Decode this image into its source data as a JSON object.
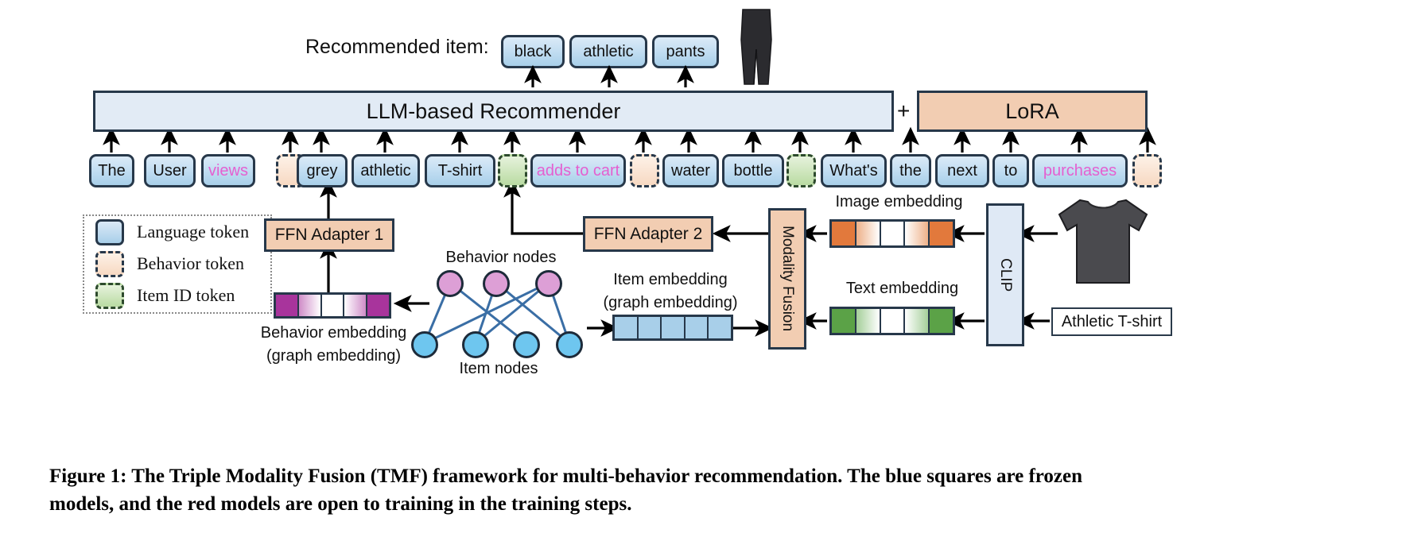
{
  "figure": {
    "recommended_label": "Recommended item:",
    "recommended_tokens": [
      "black",
      "athletic",
      "pants"
    ],
    "recommender_bar": "LLM-based Recommender",
    "plus": "+",
    "lora": "LoRA"
  },
  "tokens": [
    {
      "text": "The",
      "type": "lang"
    },
    {
      "text": "User",
      "type": "lang"
    },
    {
      "text": "views",
      "type": "lang",
      "pink": true
    },
    {
      "text": "",
      "type": "behav"
    },
    {
      "text": "grey",
      "type": "lang"
    },
    {
      "text": "athletic",
      "type": "lang"
    },
    {
      "text": "T-shirt",
      "type": "lang"
    },
    {
      "text": "",
      "type": "itemid"
    },
    {
      "text": "adds to cart",
      "type": "lang",
      "pink": true
    },
    {
      "text": "",
      "type": "behav"
    },
    {
      "text": "water",
      "type": "lang"
    },
    {
      "text": "bottle",
      "type": "lang"
    },
    {
      "text": "",
      "type": "itemid"
    },
    {
      "text": "What's",
      "type": "lang"
    },
    {
      "text": "the",
      "type": "lang"
    },
    {
      "text": "next",
      "type": "lang"
    },
    {
      "text": "to",
      "type": "lang"
    },
    {
      "text": "purchases",
      "type": "lang",
      "pink": true
    },
    {
      "text": "",
      "type": "behav"
    }
  ],
  "legend": {
    "items": [
      {
        "label": "Language token",
        "type": "lang"
      },
      {
        "label": "Behavior token",
        "type": "behav"
      },
      {
        "label": "Item ID token",
        "type": "itemid"
      }
    ]
  },
  "modules": {
    "ffn_adapter_1": "FFN Adapter 1",
    "ffn_adapter_2": "FFN Adapter 2",
    "modality_fusion": "Modality Fusion",
    "clip": "CLIP",
    "product_text": "Athletic T-shirt"
  },
  "labels": {
    "behavior_nodes": "Behavior nodes",
    "item_nodes": "Item nodes",
    "behavior_embedding_l1": "Behavior embedding",
    "behavior_embedding_l2": "(graph embedding)",
    "item_embedding_l1": "Item embedding",
    "item_embedding_l2": "(graph embedding)",
    "image_embedding": "Image embedding",
    "text_embedding": "Text embedding"
  },
  "caption": {
    "line1": "Figure 1: The Triple Modality Fusion (TMF) framework for multi-behavior recommendation. The blue squares are frozen",
    "line2": "models, and the red models are open to training in the training steps."
  },
  "colors": {
    "language_token": "#a8cfe9",
    "behavior_token": "#f7d9c2",
    "item_id_token": "#b9dba2",
    "lora": "#f2cdb2",
    "recommender": "#e2ebf5",
    "behavior_embedding": "#a8349c",
    "image_embedding": "#e2793c",
    "text_embedding": "#5ba247",
    "item_embedding": "#a8cfe9",
    "pink_text": "#e55fd0",
    "outline": "#27384a"
  }
}
